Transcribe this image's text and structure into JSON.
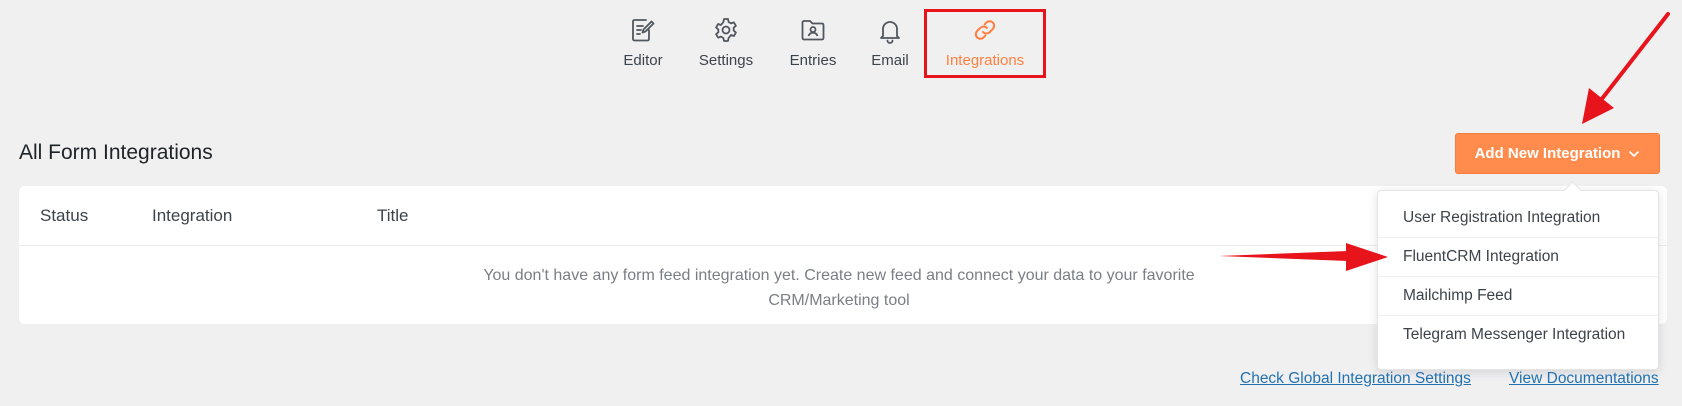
{
  "tabs": [
    {
      "key": "editor",
      "label": "Editor",
      "icon": "edit-form-icon",
      "active": false
    },
    {
      "key": "settings",
      "label": "Settings",
      "icon": "gear-icon",
      "active": false
    },
    {
      "key": "entries",
      "label": "Entries",
      "icon": "entries-folder-icon",
      "active": false
    },
    {
      "key": "email",
      "label": "Email",
      "icon": "bell-icon",
      "active": false
    },
    {
      "key": "integrations",
      "label": "Integrations",
      "icon": "link-icon",
      "active": true
    }
  ],
  "header": {
    "title": "All Form Integrations",
    "add_button_label": "Add New Integration"
  },
  "table": {
    "columns": [
      "Status",
      "Integration",
      "Title"
    ],
    "empty_message_line1": "You don't have any form feed integration yet. Create new feed and connect your data to your favorite",
    "empty_message_line2": "CRM/Marketing tool"
  },
  "dropdown": {
    "items": [
      "User Registration Integration",
      "FluentCRM Integration",
      "Mailchimp Feed",
      "Telegram Messenger Integration"
    ]
  },
  "footer": {
    "global_settings_link": "Check Global Integration Settings",
    "docs_link": "View Documentations"
  },
  "colors": {
    "accent": "#ff8c4d",
    "active_tab": "#ff7f3f",
    "annotation": "#e8141c",
    "link": "#2271b1",
    "background": "#f0f0f1"
  }
}
